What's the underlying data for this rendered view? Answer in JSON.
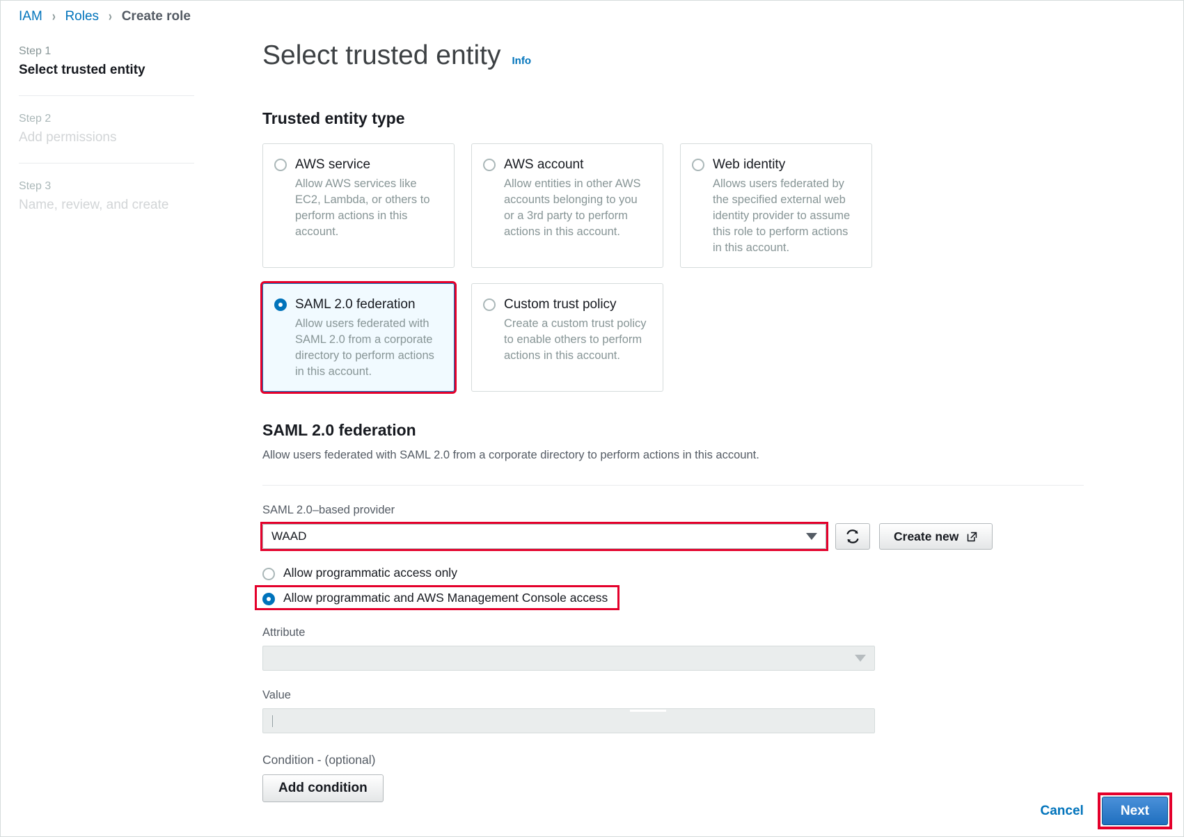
{
  "breadcrumb": {
    "items": [
      {
        "label": "IAM",
        "current": false
      },
      {
        "label": "Roles",
        "current": false
      },
      {
        "label": "Create role",
        "current": true
      }
    ],
    "separator": "›"
  },
  "sidebar": {
    "steps": [
      {
        "number": "Step 1",
        "title": "Select trusted entity",
        "state": "active"
      },
      {
        "number": "Step 2",
        "title": "Add permissions",
        "state": "inactive"
      },
      {
        "number": "Step 3",
        "title": "Name, review, and create",
        "state": "inactive"
      }
    ]
  },
  "main": {
    "page_title": "Select trusted entity",
    "info_label": "Info",
    "section_title": "Trusted entity type",
    "cards": [
      {
        "label": "AWS service",
        "desc": "Allow AWS services like EC2, Lambda, or others to perform actions in this account.",
        "selected": false,
        "annotated": false
      },
      {
        "label": "AWS account",
        "desc": "Allow entities in other AWS accounts belonging to you or a 3rd party to perform actions in this account.",
        "selected": false,
        "annotated": false
      },
      {
        "label": "Web identity",
        "desc": "Allows users federated by the specified external web identity provider to assume this role to perform actions in this account.",
        "selected": false,
        "annotated": false
      },
      {
        "label": "SAML 2.0 federation",
        "desc": "Allow users federated with SAML 2.0 from a corporate directory to perform actions in this account.",
        "selected": true,
        "annotated": true
      },
      {
        "label": "Custom trust policy",
        "desc": "Create a custom trust policy to enable others to perform actions in this account.",
        "selected": false,
        "annotated": false
      }
    ],
    "federation": {
      "title": "SAML 2.0 federation",
      "description": "Allow users federated with SAML 2.0 from a corporate directory to perform actions in this account.",
      "provider_label": "SAML 2.0–based provider",
      "provider_value": "WAAD",
      "refresh_icon": "refresh-icon",
      "create_new_label": "Create new",
      "create_new_icon": "external-link-icon",
      "access_options": [
        {
          "label": "Allow programmatic access only",
          "selected": false,
          "annotated": false
        },
        {
          "label": "Allow programmatic and AWS Management Console access",
          "selected": true,
          "annotated": true
        }
      ],
      "attribute_label": "Attribute",
      "attribute_value": "",
      "value_label": "Value",
      "value_value": "",
      "condition_label": "Condition - (optional)",
      "add_condition_label": "Add condition"
    }
  },
  "footer": {
    "cancel_label": "Cancel",
    "next_label": "Next"
  },
  "colors": {
    "link": "#0073bb",
    "annotation": "#e4002b",
    "selected_card_bg": "#f1faff",
    "primary_button": "#1f6fbf",
    "muted_text": "#879596"
  }
}
